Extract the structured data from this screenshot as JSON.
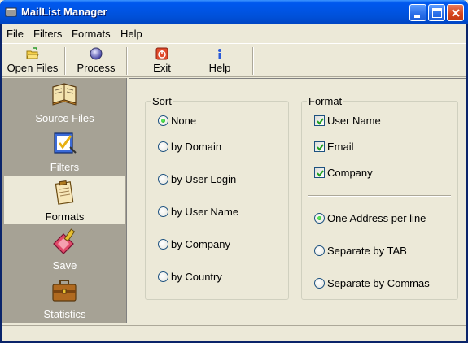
{
  "window": {
    "title": "MailList Manager",
    "accent": "#0054e3"
  },
  "menu": [
    "File",
    "Filters",
    "Formats",
    "Help"
  ],
  "toolbar": {
    "open_files": {
      "label": "Open Files",
      "icon": "open-folder-icon"
    },
    "process": {
      "label": "Process",
      "icon": "process-orb-icon"
    },
    "exit": {
      "label": "Exit",
      "icon": "power-icon"
    },
    "help": {
      "label": "Help",
      "icon": "info-icon"
    }
  },
  "sidebar": {
    "items": [
      {
        "label": "Source Files",
        "icon": "book-icon",
        "active": false
      },
      {
        "label": "Filters",
        "icon": "checklist-icon",
        "active": false
      },
      {
        "label": "Formats",
        "icon": "notepad-icon",
        "active": true
      },
      {
        "label": "Save",
        "icon": "eraser-icon",
        "active": false
      },
      {
        "label": "Statistics",
        "icon": "briefcase-icon",
        "active": false
      }
    ]
  },
  "sort": {
    "legend": "Sort",
    "selected": "None",
    "options": [
      "None",
      "by Domain",
      "by User Login",
      "by User Name",
      "by Company",
      "by Country"
    ]
  },
  "format": {
    "legend": "Format",
    "fields": [
      {
        "label": "User Name",
        "checked": true
      },
      {
        "label": "Email",
        "checked": true
      },
      {
        "label": "Company",
        "checked": true
      }
    ],
    "separator_selected": "One Address per line",
    "separators": [
      "One Address per line",
      "Separate by TAB",
      "Separate by Commas"
    ]
  }
}
